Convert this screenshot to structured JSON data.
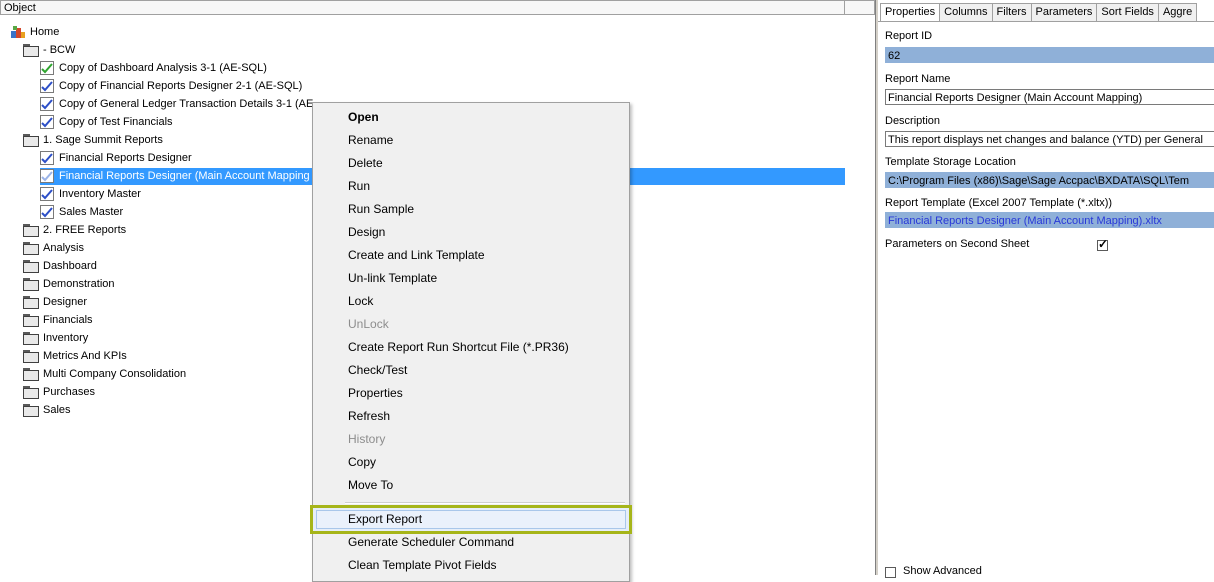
{
  "tree": {
    "column_header": "Object",
    "root": "Home",
    "folders": [
      {
        "label": "- BCW",
        "children": [
          "Copy of Dashboard Analysis 3-1 (AE-SQL)",
          "Copy of Financial Reports Designer 2-1 (AE-SQL)",
          "Copy of General Ledger Transaction Details 3-1 (AE",
          "Copy of Test Financials"
        ]
      },
      {
        "label": "1. Sage Summit Reports",
        "children": [
          "Financial Reports Designer",
          "Financial Reports Designer (Main Account Mapping",
          "Inventory Master",
          "Sales Master"
        ]
      },
      {
        "label": "2. FREE Reports"
      },
      {
        "label": "Analysis"
      },
      {
        "label": "Dashboard"
      },
      {
        "label": "Demonstration"
      },
      {
        "label": "Designer"
      },
      {
        "label": "Financials"
      },
      {
        "label": "Inventory"
      },
      {
        "label": "Metrics And KPIs"
      },
      {
        "label": "Multi Company Consolidation"
      },
      {
        "label": "Purchases"
      },
      {
        "label": "Sales"
      }
    ]
  },
  "context_menu": {
    "items": [
      "Open",
      "Rename",
      "Delete",
      "Run",
      "Run Sample",
      "Design",
      "Create and Link Template",
      "Un-link Template",
      "Lock",
      "UnLock",
      "Create Report Run Shortcut File (*.PR36)",
      "Check/Test",
      "Properties",
      "Refresh",
      "History",
      "Copy",
      "Move To",
      "Export Report",
      "Generate Scheduler Command",
      "Clean Template Pivot Fields"
    ],
    "highlight_color": "#a6b519"
  },
  "properties": {
    "tabs": [
      "Properties",
      "Columns",
      "Filters",
      "Parameters",
      "Sort Fields",
      "Aggre"
    ],
    "report_id_label": "Report ID",
    "report_id": "62",
    "report_name_label": "Report Name",
    "report_name": "Financial Reports Designer (Main Account Mapping)",
    "description_label": "Description",
    "description": "This report displays net changes and balance (YTD) per General",
    "template_location_label": "Template Storage Location",
    "template_location": "C:\\Program Files (x86)\\Sage\\Sage Accpac\\BXDATA\\SQL\\Tem",
    "report_template_label": "Report Template (Excel 2007 Template (*.xltx))",
    "report_template": "Financial Reports Designer (Main Account Mapping).xltx",
    "params_second_sheet_label": "Parameters on Second Sheet",
    "params_second_sheet_checked": true,
    "show_advanced_label": "Show Advanced"
  }
}
